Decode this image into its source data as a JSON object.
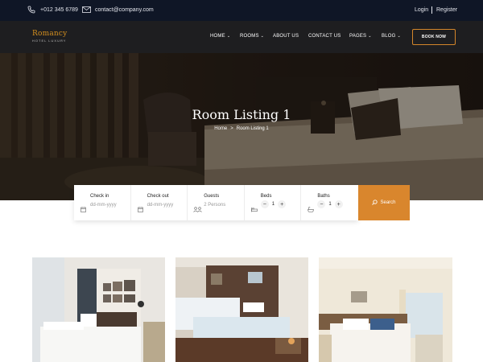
{
  "topbar": {
    "phone": "+012 345 6789",
    "email": "contact@company.com",
    "login": "Login",
    "register": "Register",
    "icons": [
      "phone-icon",
      "mail-icon"
    ]
  },
  "brand": {
    "name": "Romancy",
    "tagline": "HOTEL LUXURY",
    "accent_color": "#d4862a"
  },
  "nav": {
    "items": [
      {
        "label": "HOME",
        "has_dropdown": true
      },
      {
        "label": "ROOMS",
        "has_dropdown": true
      },
      {
        "label": "ABOUT US",
        "has_dropdown": false
      },
      {
        "label": "CONTACT US",
        "has_dropdown": false
      },
      {
        "label": "PAGES",
        "has_dropdown": true
      },
      {
        "label": "BLOG",
        "has_dropdown": true
      }
    ],
    "chevron": "⌄",
    "book_now": "BOOK NOW"
  },
  "hero": {
    "title": "Room Listing 1",
    "breadcrumb": {
      "home": "Home",
      "separator": ">",
      "current": "Room Listing 1"
    }
  },
  "booking": {
    "checkin": {
      "label": "Check in",
      "placeholder": "dd-mm-yyyy",
      "icon": "calendar-icon"
    },
    "checkout": {
      "label": "Check out",
      "placeholder": "dd-mm-yyyy",
      "icon": "calendar-icon"
    },
    "guests": {
      "label": "Guests",
      "value": "2  Persons",
      "icon": "people-icon"
    },
    "beds": {
      "label": "Beds",
      "value": "1",
      "minus": "−",
      "plus": "+",
      "icon": "bed-icon"
    },
    "baths": {
      "label": "Baths",
      "value": "1",
      "minus": "−",
      "plus": "+",
      "icon": "bath-icon"
    },
    "search_label": "Search",
    "search_color": "#d9862d"
  }
}
